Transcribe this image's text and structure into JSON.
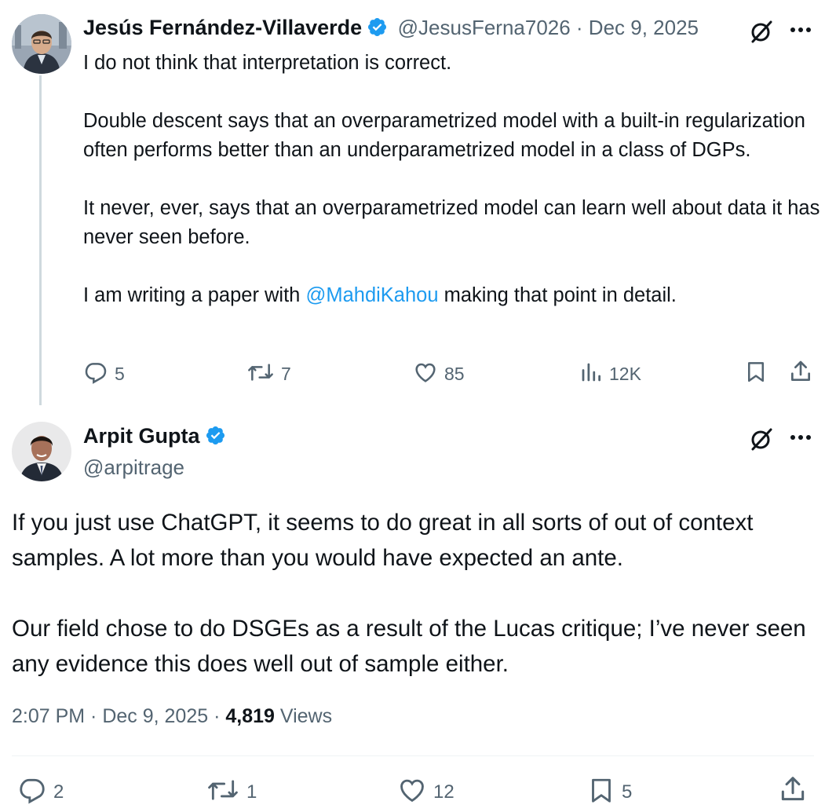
{
  "colors": {
    "accent": "#1d9bf0",
    "text": "#0f1419",
    "muted": "#536471",
    "line": "#cfd9de"
  },
  "tweet1": {
    "author_name": "Jesús Fernández-Villaverde",
    "handle_and_date": "@JesusFerna7026 · Dec 9, 2025",
    "para1": "I do not think that interpretation is correct.",
    "para2": "Double descent says that an overparametrized model with a built-in regularization often performs better than an underparametrized model in a class of DGPs.",
    "para3": "It never, ever, says that an overparametrized model can learn well about data it has never seen before.",
    "para4_before": "I am writing a paper with ",
    "para4_mention": "@MahdiKahou",
    "para4_after": " making that point in detail.",
    "replies": "5",
    "reposts": "7",
    "likes": "85",
    "views": "12K",
    "icons": [
      "reply-icon",
      "repost-icon",
      "like-icon",
      "views-icon",
      "bookmark-icon",
      "share-icon",
      "grok-icon",
      "more-icon"
    ]
  },
  "tweet2": {
    "author_name": "Arpit Gupta",
    "handle": "@arpitrage",
    "para1": "If you just use ChatGPT, it seems to do great in all sorts of out of context samples. A lot more than you would have expected an ante.",
    "para2": "Our field chose to do DSGEs as a result of the Lucas critique; I’ve never seen any evidence this does well out of sample either.",
    "time_date": "2:07 PM · Dec 9, 2025 · ",
    "views_count": "4,819",
    "views_label": " Views",
    "replies": "2",
    "reposts": "1",
    "likes": "12",
    "bookmarks": "5"
  }
}
